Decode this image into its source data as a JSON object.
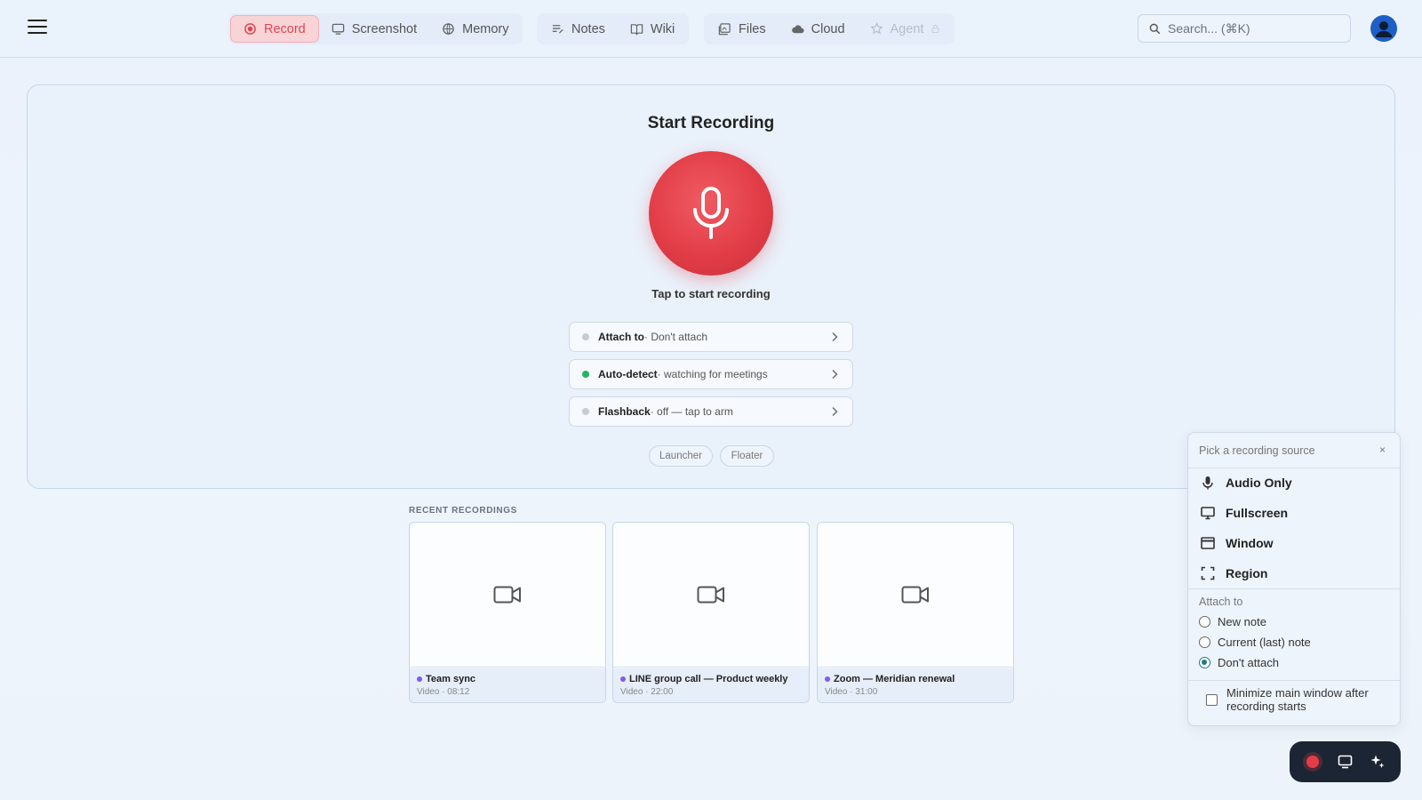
{
  "nav": {
    "groups": [
      [
        {
          "label": "Record",
          "icon": "record-icon",
          "active": true
        },
        {
          "label": "Screenshot",
          "icon": "screenshot-icon"
        },
        {
          "label": "Memory",
          "icon": "memory-icon"
        }
      ],
      [
        {
          "label": "Notes",
          "icon": "notes-icon"
        },
        {
          "label": "Wiki",
          "icon": "wiki-icon"
        }
      ],
      [
        {
          "label": "Files",
          "icon": "files-icon"
        },
        {
          "label": "Cloud",
          "icon": "cloud-icon"
        },
        {
          "label": "Agent",
          "icon": "agent-icon",
          "disabled": true,
          "locked": true
        }
      ]
    ]
  },
  "search": {
    "placeholder": "Search... (⌘K)"
  },
  "main": {
    "title": "Start Recording",
    "tap_hint": "Tap to start recording",
    "options": [
      {
        "label": "Attach to",
        "value": " · Don't attach",
        "status": "gray"
      },
      {
        "label": "Auto-detect",
        "value": " · watching for meetings",
        "status": "green"
      },
      {
        "label": "Flashback",
        "value": " · off — tap to arm",
        "status": "gray"
      }
    ],
    "modes": [
      "Launcher",
      "Floater"
    ]
  },
  "recent": {
    "label": "RECENT RECORDINGS",
    "items": [
      {
        "name": "Team sync",
        "sub": "Video · 08:12"
      },
      {
        "name": "LINE group call — Product weekly",
        "sub": "Video · 22:00"
      },
      {
        "name": "Zoom — Meridian renewal",
        "sub": "Video · 31:00"
      }
    ]
  },
  "popup": {
    "title": "Pick a recording source",
    "close": "×",
    "sources": [
      "Audio Only",
      "Fullscreen",
      "Window",
      "Region"
    ],
    "attach_heading": "Attach to",
    "attach_options": [
      "New note",
      "Current (last) note",
      "Don't attach"
    ],
    "attach_selected": "Don't attach",
    "minimize_label": "Minimize main window after recording starts",
    "minimize_checked": false
  },
  "colors": {
    "accent": "#e23d47",
    "active_tab_bg": "#f8d4d7",
    "status_green": "#22b462",
    "radio_selected": "#1e7a8c"
  }
}
